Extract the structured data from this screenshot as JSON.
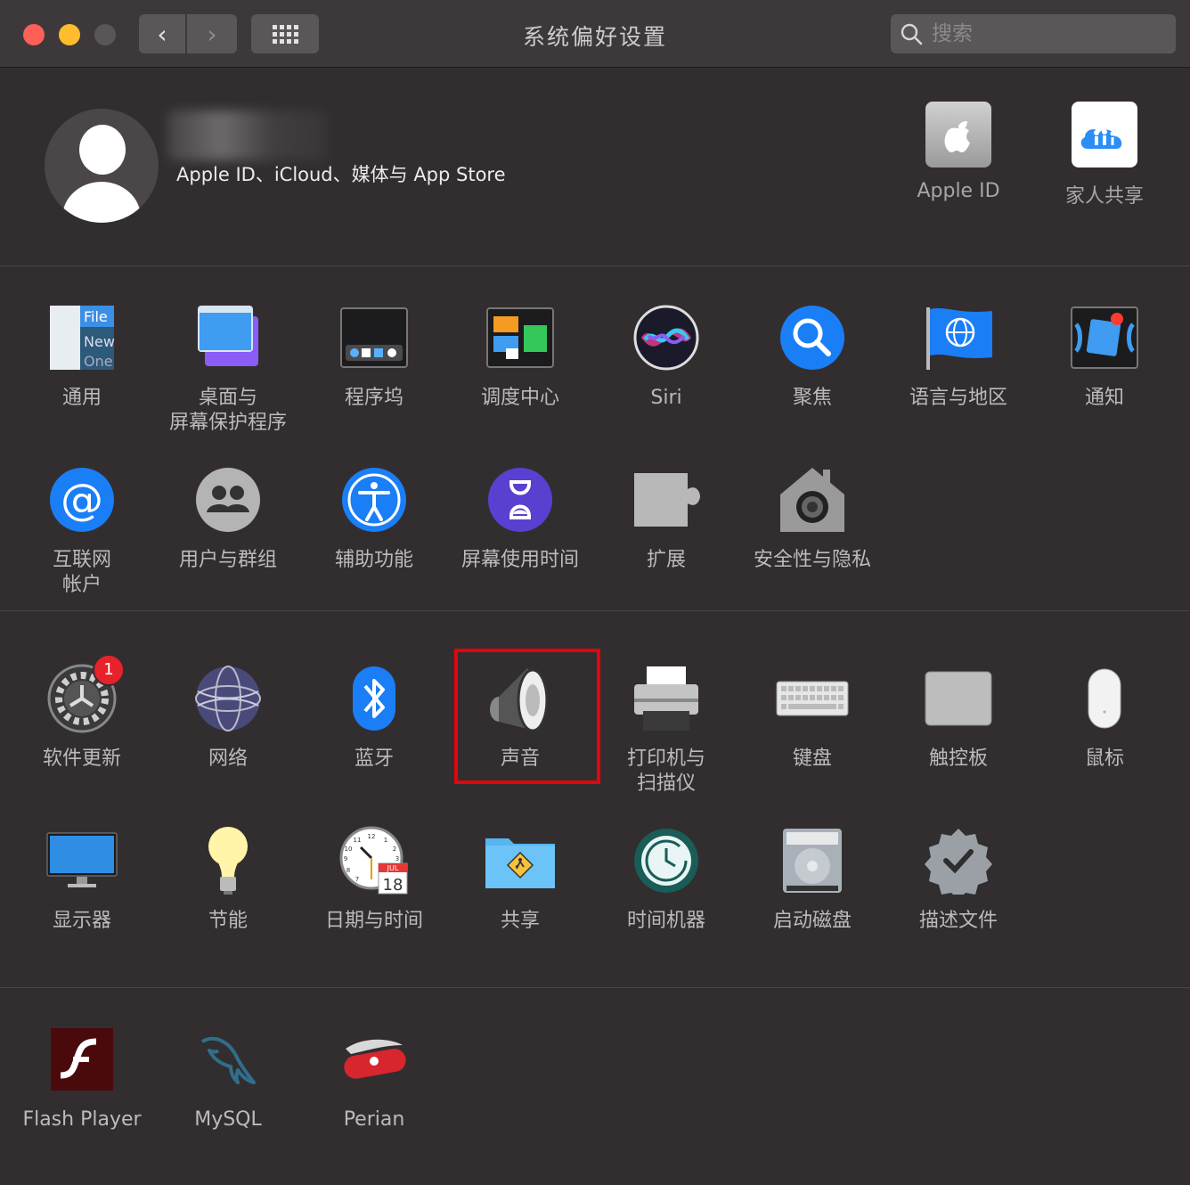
{
  "window": {
    "title": "系统偏好设置"
  },
  "toolbar": {
    "back": "‹",
    "forward": "›"
  },
  "search": {
    "placeholder": "搜索"
  },
  "account": {
    "subtitle": "Apple ID、iCloud、媒体与 App Store",
    "apple_id_label": "Apple ID",
    "family_label": "家人共享"
  },
  "section1": [
    {
      "name": "general",
      "label": "通用"
    },
    {
      "name": "desktop",
      "label": "桌面与\n屏幕保护程序"
    },
    {
      "name": "dock",
      "label": "程序坞"
    },
    {
      "name": "mission-control",
      "label": "调度中心"
    },
    {
      "name": "siri",
      "label": "Siri"
    },
    {
      "name": "spotlight",
      "label": "聚焦"
    },
    {
      "name": "language",
      "label": "语言与地区"
    },
    {
      "name": "notifications",
      "label": "通知"
    },
    {
      "name": "internet-accounts",
      "label": "互联网\n帐户"
    },
    {
      "name": "users-groups",
      "label": "用户与群组"
    },
    {
      "name": "accessibility",
      "label": "辅助功能"
    },
    {
      "name": "screen-time",
      "label": "屏幕使用时间"
    },
    {
      "name": "extensions",
      "label": "扩展"
    },
    {
      "name": "security",
      "label": "安全性与隐私"
    }
  ],
  "section2": [
    {
      "name": "software-update",
      "label": "软件更新",
      "badge": "1"
    },
    {
      "name": "network",
      "label": "网络"
    },
    {
      "name": "bluetooth",
      "label": "蓝牙"
    },
    {
      "name": "sound",
      "label": "声音"
    },
    {
      "name": "printers",
      "label": "打印机与\n扫描仪"
    },
    {
      "name": "keyboard",
      "label": "键盘"
    },
    {
      "name": "trackpad",
      "label": "触控板"
    },
    {
      "name": "mouse",
      "label": "鼠标"
    },
    {
      "name": "displays",
      "label": "显示器"
    },
    {
      "name": "energy",
      "label": "节能"
    },
    {
      "name": "date-time",
      "label": "日期与时间"
    },
    {
      "name": "sharing",
      "label": "共享"
    },
    {
      "name": "time-machine",
      "label": "时间机器"
    },
    {
      "name": "startup-disk",
      "label": "启动磁盘"
    },
    {
      "name": "profiles",
      "label": "描述文件"
    }
  ],
  "section3": [
    {
      "name": "flash-player",
      "label": "Flash Player"
    },
    {
      "name": "mysql",
      "label": "MySQL"
    },
    {
      "name": "perian",
      "label": "Perian"
    }
  ],
  "icon_text": {
    "general_file": "File",
    "general_new": "New",
    "general_one": "One",
    "calendar_month": "JUL",
    "calendar_day": "18",
    "clock_12": "12",
    "clock_11": "11",
    "clock_1": "1",
    "clock_10": "10",
    "clock_2": "2",
    "clock_9": "9",
    "clock_3": "3",
    "clock_8": "8",
    "clock_7": "7",
    "siri_at": "@"
  },
  "colors": {
    "highlight": "#e4040c",
    "badge": "#e7222b",
    "accent_blue": "#1a7ef6"
  }
}
